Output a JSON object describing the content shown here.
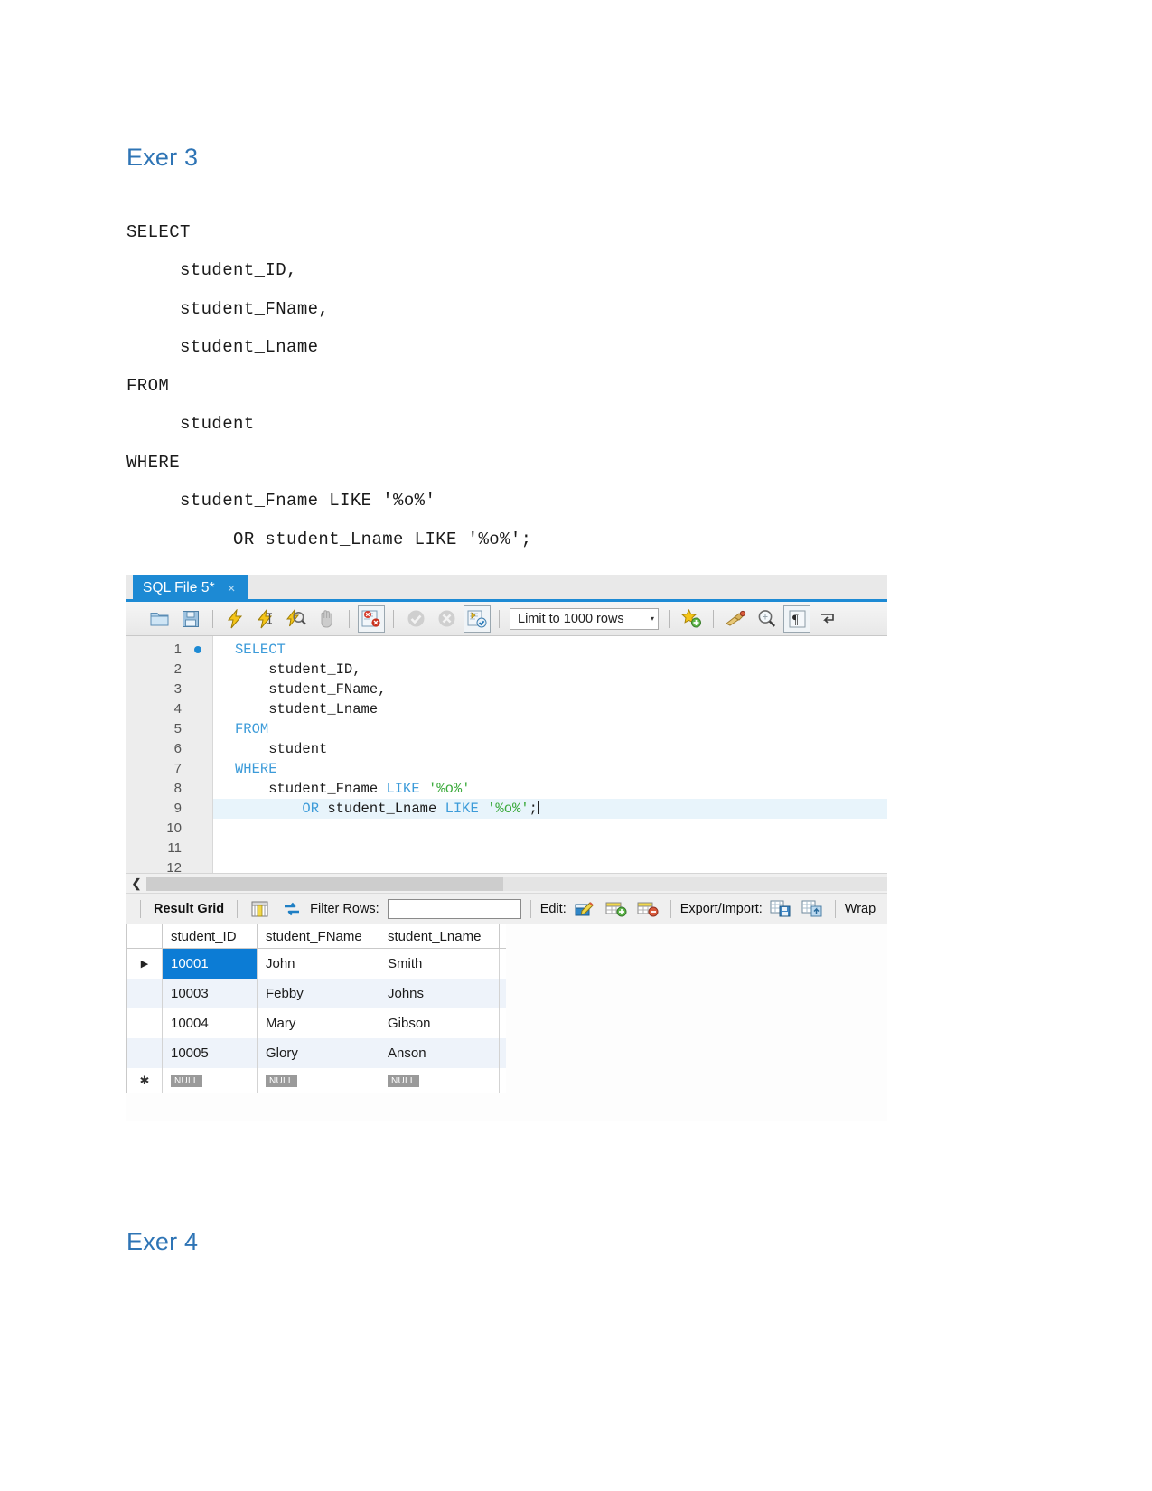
{
  "document": {
    "heading_1": "Exer 3",
    "heading_2": "Exer 4",
    "sql_lines": [
      "SELECT",
      "     student_ID,",
      "     student_FName,",
      "     student_Lname",
      "FROM",
      "     student",
      "WHERE",
      "     student_Fname LIKE '%o%'",
      "          OR student_Lname LIKE '%o%';"
    ]
  },
  "workbench": {
    "tab": {
      "label": "SQL File 5*",
      "close": "×"
    },
    "toolbar": {
      "buttons": [
        {
          "name": "open-sql-script-icon",
          "glyph": "folder"
        },
        {
          "name": "save-script-icon",
          "glyph": "floppy"
        },
        {
          "name": "execute-statement-icon",
          "glyph": "bolt"
        },
        {
          "name": "execute-current-statement-icon",
          "glyph": "bolt-cursor"
        },
        {
          "name": "explain-statement-icon",
          "glyph": "bolt-magnifier"
        },
        {
          "name": "stop-script-icon",
          "glyph": "hand"
        },
        {
          "name": "toggle-stop-on-error-icon",
          "glyph": "stop-error"
        },
        {
          "name": "commit-icon",
          "glyph": "check"
        },
        {
          "name": "rollback-icon",
          "glyph": "cross"
        },
        {
          "name": "toggle-autocommit-icon",
          "glyph": "autocommit"
        }
      ],
      "limit_label": "Limit to 1000 rows",
      "limit_caret": "▾",
      "right_buttons": [
        {
          "name": "save-snippet-icon",
          "glyph": "star-plus"
        },
        {
          "name": "beautify-query-icon",
          "glyph": "broom"
        },
        {
          "name": "find-icon",
          "glyph": "magnifier"
        },
        {
          "name": "show-invisible-chars-icon",
          "glyph": "pilcrow"
        },
        {
          "name": "toggle-wrapping-icon",
          "glyph": "wrap"
        }
      ]
    },
    "editor": {
      "line_numbers": [
        "1",
        "2",
        "3",
        "4",
        "5",
        "6",
        "7",
        "8",
        "9",
        "10",
        "11",
        "12"
      ],
      "breakpoint_line": 1,
      "current_line": 9,
      "code": [
        {
          "n": 1,
          "tokens": [
            {
              "t": "SELECT",
              "c": "kw"
            }
          ]
        },
        {
          "n": 2,
          "tokens": [
            {
              "t": "    student_ID,",
              "c": ""
            }
          ]
        },
        {
          "n": 3,
          "tokens": [
            {
              "t": "    student_FName,",
              "c": ""
            }
          ]
        },
        {
          "n": 4,
          "tokens": [
            {
              "t": "    student_Lname",
              "c": ""
            }
          ]
        },
        {
          "n": 5,
          "tokens": [
            {
              "t": "FROM",
              "c": "kw"
            }
          ]
        },
        {
          "n": 6,
          "tokens": [
            {
              "t": "    student",
              "c": ""
            }
          ]
        },
        {
          "n": 7,
          "tokens": [
            {
              "t": "WHERE",
              "c": "kw"
            }
          ]
        },
        {
          "n": 8,
          "tokens": [
            {
              "t": "    student_Fname ",
              "c": ""
            },
            {
              "t": "LIKE",
              "c": "kw"
            },
            {
              "t": " ",
              "c": ""
            },
            {
              "t": "'%o%'",
              "c": "str"
            }
          ]
        },
        {
          "n": 9,
          "tokens": [
            {
              "t": "        ",
              "c": ""
            },
            {
              "t": "OR",
              "c": "kw"
            },
            {
              "t": " student_Lname ",
              "c": ""
            },
            {
              "t": "LIKE",
              "c": "kw"
            },
            {
              "t": " ",
              "c": ""
            },
            {
              "t": "'%o%'",
              "c": "str"
            },
            {
              "t": ";",
              "c": ""
            }
          ]
        },
        {
          "n": 10,
          "tokens": []
        },
        {
          "n": 11,
          "tokens": []
        },
        {
          "n": 12,
          "tokens": []
        }
      ]
    },
    "result_toolbar": {
      "result_grid_label": "Result Grid",
      "grid_view_icon": "grid-view-icon",
      "refresh_icon": "refresh-icon",
      "filter_label": "Filter Rows:",
      "filter_value": "",
      "filter_placeholder": "",
      "edit_label": "Edit:",
      "edit_icons": [
        "edit-row-icon",
        "add-row-icon",
        "delete-row-icon"
      ],
      "export_label": "Export/Import:",
      "export_icons": [
        "export-recordset-icon",
        "import-recordset-icon"
      ],
      "wrap_label": "Wrap"
    },
    "results": {
      "columns": [
        "student_ID",
        "student_FName",
        "student_Lname"
      ],
      "rows": [
        {
          "marker": "▶",
          "cells": [
            "10001",
            "John",
            "Smith"
          ],
          "selected_cell": 0
        },
        {
          "marker": "",
          "cells": [
            "10003",
            "Febby",
            "Johns"
          ],
          "selected_cell": -1
        },
        {
          "marker": "",
          "cells": [
            "10004",
            "Mary",
            "Gibson"
          ],
          "selected_cell": -1
        },
        {
          "marker": "",
          "cells": [
            "10005",
            "Glory",
            "Anson"
          ],
          "selected_cell": -1
        }
      ],
      "new_row": {
        "marker": "✱",
        "cells": [
          "NULL",
          "NULL",
          "NULL"
        ]
      }
    }
  },
  "colors": {
    "heading": "#2E74B5",
    "tab_active": "#1d8ad4",
    "keyword": "#3c9bd9",
    "string": "#3caa3c",
    "selection": "#0c7cd5",
    "alt_row": "#eef3fa"
  }
}
